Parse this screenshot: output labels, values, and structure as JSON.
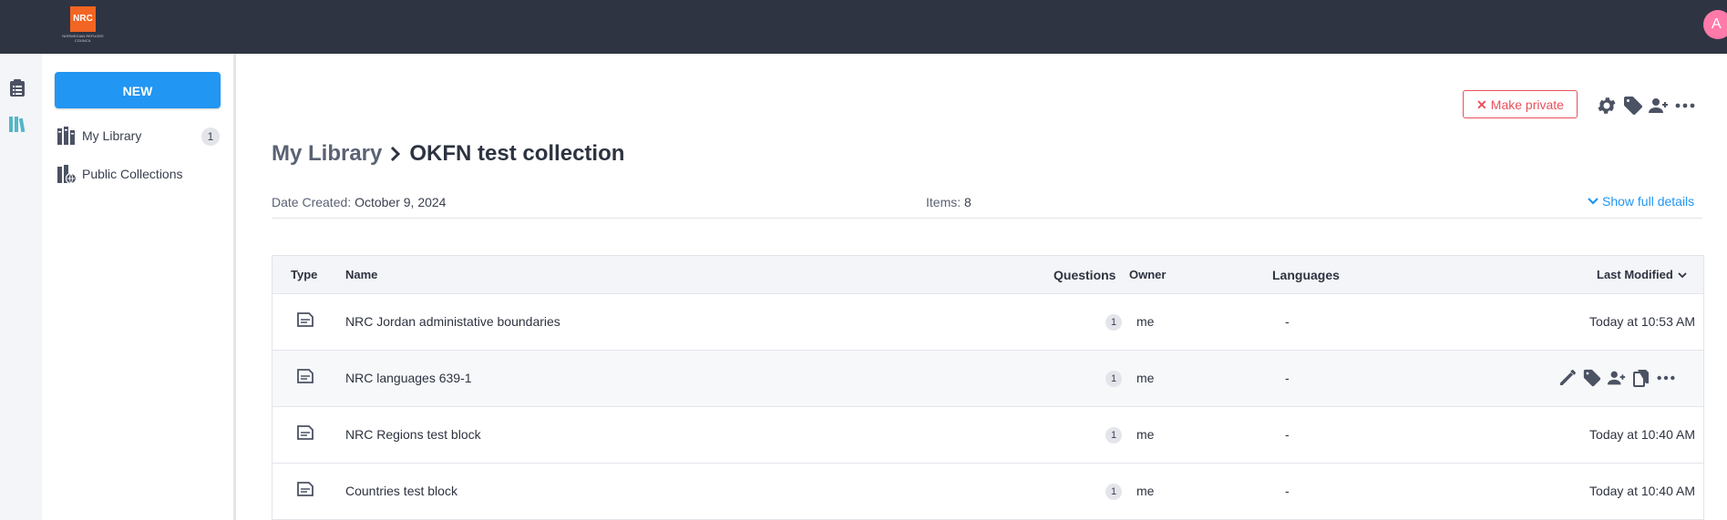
{
  "topbar": {
    "logo_text": "NRC",
    "logo_subtext": "NORWEGIAN REFUGEE COUNCIL",
    "avatar_letter": "A"
  },
  "sidebar": {
    "new_label": "NEW",
    "items": [
      {
        "label": "My Library",
        "count": "1"
      },
      {
        "label": "Public Collections"
      }
    ]
  },
  "header": {
    "make_private_label": "Make private",
    "breadcrumb_parent": "My Library",
    "breadcrumb_current": "OKFN test collection",
    "date_created_label": "Date Created:",
    "date_created_value": "October 9, 2024",
    "items_label": "Items:",
    "items_value": "8",
    "show_full_details": "Show full details"
  },
  "table": {
    "columns": {
      "type": "Type",
      "name": "Name",
      "questions": "Questions",
      "owner": "Owner",
      "languages": "Languages",
      "last_modified": "Last Modified"
    },
    "rows": [
      {
        "name": "NRC Jordan administative boundaries",
        "questions": "1",
        "owner": "me",
        "languages": "-",
        "modified": "Today at 10:53 AM"
      },
      {
        "name": "NRC languages 639-1",
        "questions": "1",
        "owner": "me",
        "languages": "-",
        "modified": ""
      },
      {
        "name": "NRC Regions test block",
        "questions": "1",
        "owner": "me",
        "languages": "-",
        "modified": "Today at 10:40 AM"
      },
      {
        "name": "Countries test block",
        "questions": "1",
        "owner": "me",
        "languages": "-",
        "modified": "Today at 10:40 AM"
      }
    ]
  },
  "colors": {
    "topbar": "#2f3443",
    "accent": "#2196f3",
    "danger": "#e8505b",
    "avatar": "#ff7aa8",
    "logo": "#f26522"
  }
}
